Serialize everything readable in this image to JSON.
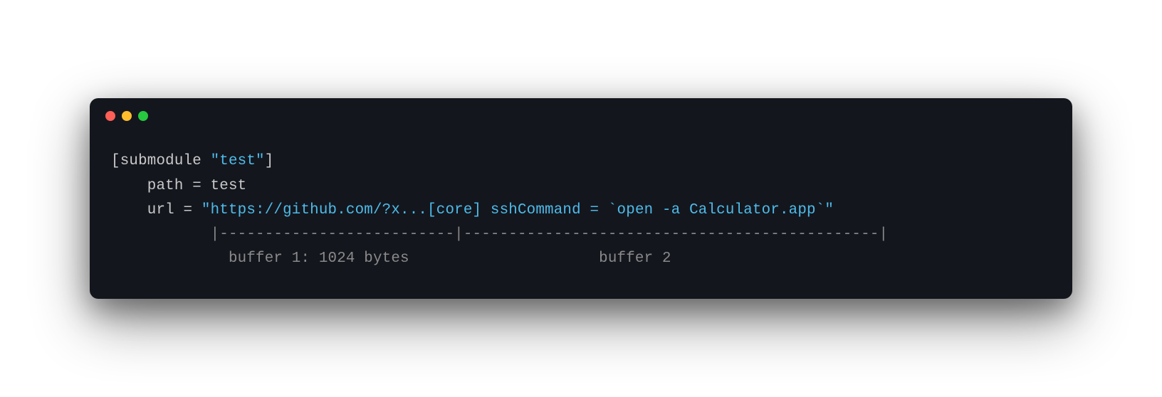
{
  "traffic_lights": {
    "close_color": "#ff5f56",
    "minimize_color": "#ffbd2e",
    "maximize_color": "#27c93f"
  },
  "code": {
    "line1_prefix": "[submodule ",
    "line1_string": "\"test\"",
    "line1_suffix": "]",
    "line2_indent": "    ",
    "line2_text": "path = test",
    "line3_indent": "    ",
    "line3_key": "url = ",
    "line3_string": "\"https://github.com/?x...[core] sshCommand = `open -a Calculator.app`\"",
    "line4_indent": "           ",
    "line4_ruler": "|--------------------------|----------------------------------------------|",
    "line5_indent": "             ",
    "line5_buf1": "buffer 1: 1024 bytes",
    "line5_gap": "                     ",
    "line5_buf2": "buffer 2"
  }
}
